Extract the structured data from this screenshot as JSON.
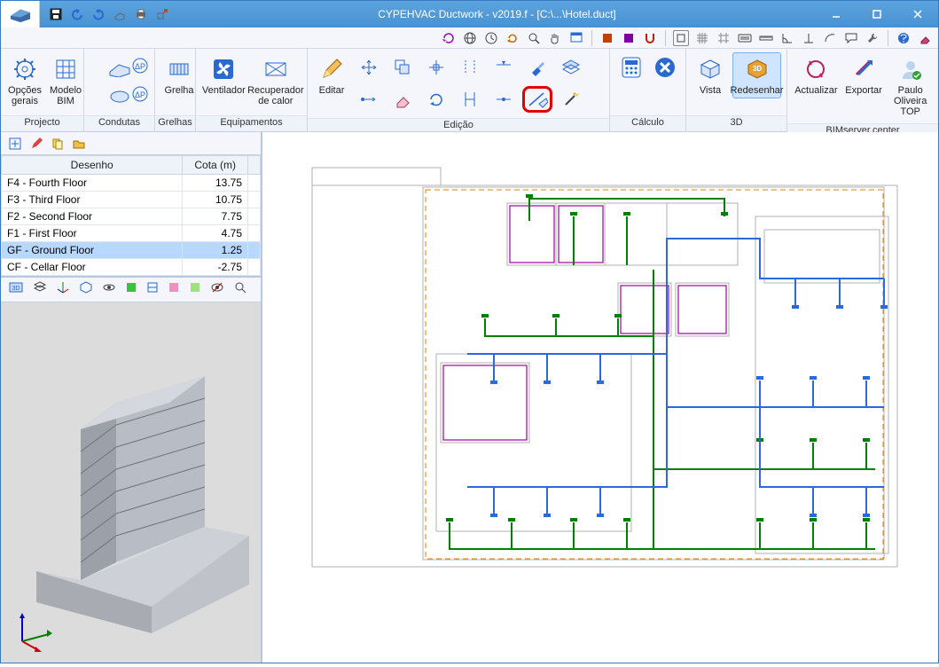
{
  "window": {
    "title": "CYPEHVAC Ductwork - v2019.f - [C:\\...\\Hotel.duct]"
  },
  "ribbon": {
    "groups": {
      "projecto": {
        "label": "Projecto",
        "btnOptions": "Opções gerais",
        "btnModelBIM": "Modelo BIM"
      },
      "condutas": {
        "label": "Condutas"
      },
      "grelhas": {
        "label": "Grelhas",
        "btnGrelha": "Grelha"
      },
      "equipamentos": {
        "label": "Equipamentos",
        "btnVentilador": "Ventilador",
        "btnRecup": "Recuperador de calor"
      },
      "edicao": {
        "label": "Edição",
        "btnEditar": "Editar"
      },
      "calculo": {
        "label": "Cálculo"
      },
      "d3": {
        "label": "3D",
        "btnVista": "Vista",
        "btnRedesenhar": "Redesenhar"
      },
      "bim": {
        "label": "BIMserver.center",
        "btnActualizar": "Actualizar",
        "btnExportar": "Exportar",
        "btnUser": "Paulo Oliveira TOP"
      }
    }
  },
  "table": {
    "headers": {
      "desenho": "Desenho",
      "cota": "Cota (m)"
    },
    "rows": [
      {
        "name": "F4 - Fourth Floor",
        "cota": "13.75"
      },
      {
        "name": "F3 - Third Floor",
        "cota": "10.75"
      },
      {
        "name": "F2 - Second Floor",
        "cota": "7.75"
      },
      {
        "name": "F1 - First Floor",
        "cota": "4.75"
      },
      {
        "name": "GF - Ground Floor",
        "cota": "1.25",
        "selected": true
      },
      {
        "name": "CF - Cellar Floor",
        "cota": "-2.75"
      }
    ]
  }
}
